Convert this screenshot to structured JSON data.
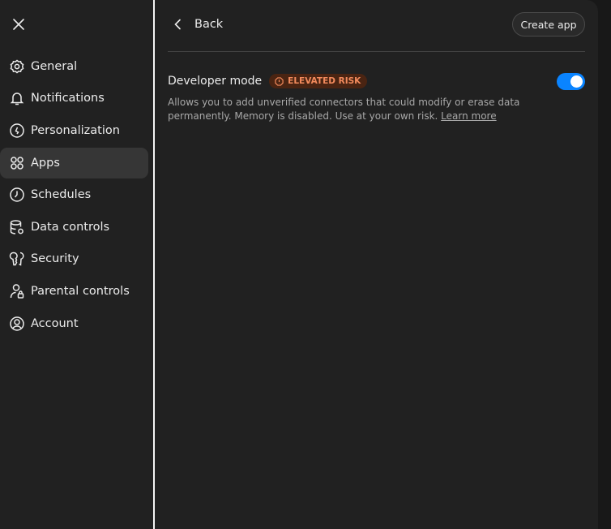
{
  "sidebar": {
    "close_icon": "close-icon",
    "items": [
      {
        "label": "General",
        "icon": "gear-icon"
      },
      {
        "label": "Notifications",
        "icon": "bell-icon"
      },
      {
        "label": "Personalization",
        "icon": "personalization-icon"
      },
      {
        "label": "Apps",
        "icon": "apps-grid-icon",
        "active": true
      },
      {
        "label": "Schedules",
        "icon": "clock-icon"
      },
      {
        "label": "Data controls",
        "icon": "database-gear-icon"
      },
      {
        "label": "Security",
        "icon": "key-icon"
      },
      {
        "label": "Parental controls",
        "icon": "user-lock-icon"
      },
      {
        "label": "Account",
        "icon": "user-circle-icon"
      }
    ]
  },
  "main": {
    "back_label": "Back",
    "create_app_label": "Create app",
    "developer_mode": {
      "label": "Developer mode",
      "badge": "ELEVATED RISK",
      "description": "Allows you to add unverified connectors that could modify or erase data permanently. Memory is disabled. Use at your own risk.",
      "learn_more": "Learn more",
      "enabled": true
    }
  },
  "colors": {
    "toggle_on": "#0a84ff",
    "badge_bg": "#4a2412",
    "badge_text": "#f28a5c",
    "active_item": "#363636"
  }
}
